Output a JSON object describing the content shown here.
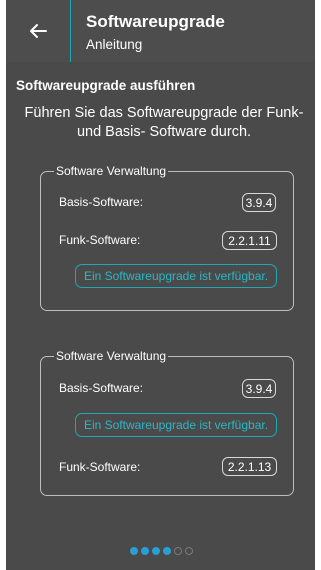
{
  "header": {
    "title": "Softwareupgrade",
    "subtitle": "Anleitung"
  },
  "section_title": "Softwareupgrade ausführen",
  "intro": "Führen Sie das Softwareupgrade der Funk- und Basis- Software durch.",
  "cards": [
    {
      "legend": "Software Verwaltung",
      "basis_label": "Basis-Software:",
      "basis_version": "3.9.4",
      "funk_label": "Funk-Software:",
      "funk_version": "2.2.1.11",
      "upgrade_label": "Ein Softwareupgrade ist verfügbar."
    },
    {
      "legend": "Software Verwaltung",
      "basis_label": "Basis-Software:",
      "basis_version": "3.9.4",
      "upgrade_label": "Ein Softwareupgrade ist verfügbar.",
      "funk_label": "Funk-Software:",
      "funk_version": "2.2.1.13"
    }
  ],
  "pager": {
    "total": 6,
    "current": 4
  },
  "colors": {
    "accent": "#1fa8b8",
    "background": "#4a4a4a",
    "dot_active": "#2a9fd6"
  },
  "icons": {
    "back": "arrow-left-icon"
  }
}
